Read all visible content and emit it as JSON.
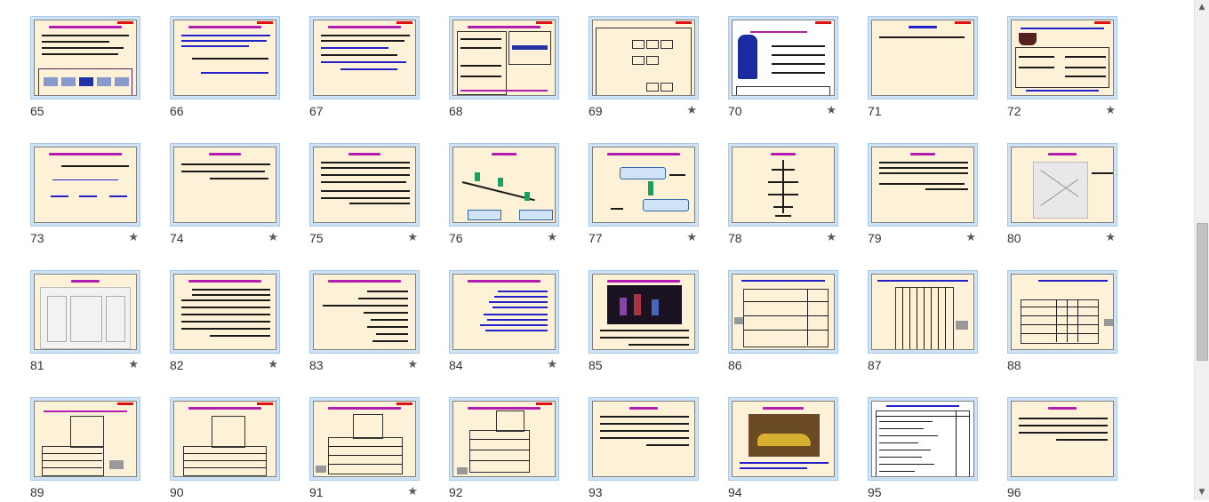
{
  "slides": [
    {
      "number": "65",
      "star": ""
    },
    {
      "number": "66",
      "star": ""
    },
    {
      "number": "67",
      "star": ""
    },
    {
      "number": "68",
      "star": ""
    },
    {
      "number": "69",
      "star": "★"
    },
    {
      "number": "70",
      "star": "★"
    },
    {
      "number": "71",
      "star": ""
    },
    {
      "number": "72",
      "star": "★"
    },
    {
      "number": "73",
      "star": "★"
    },
    {
      "number": "74",
      "star": "★"
    },
    {
      "number": "75",
      "star": "★"
    },
    {
      "number": "76",
      "star": "★"
    },
    {
      "number": "77",
      "star": "★"
    },
    {
      "number": "78",
      "star": "★"
    },
    {
      "number": "79",
      "star": "★"
    },
    {
      "number": "80",
      "star": "★"
    },
    {
      "number": "81",
      "star": "★"
    },
    {
      "number": "82",
      "star": "★"
    },
    {
      "number": "83",
      "star": "★"
    },
    {
      "number": "84",
      "star": "★"
    },
    {
      "number": "85",
      "star": ""
    },
    {
      "number": "86",
      "star": ""
    },
    {
      "number": "87",
      "star": ""
    },
    {
      "number": "88",
      "star": ""
    },
    {
      "number": "89",
      "star": ""
    },
    {
      "number": "90",
      "star": ""
    },
    {
      "number": "91",
      "star": "★"
    },
    {
      "number": "92",
      "star": ""
    },
    {
      "number": "93",
      "star": ""
    },
    {
      "number": "94",
      "star": ""
    },
    {
      "number": "95",
      "star": ""
    },
    {
      "number": "96",
      "star": ""
    }
  ],
  "scrollbar": {
    "up_icon": "▲",
    "down_icon": "▼"
  },
  "colors": {
    "slide_bg": "#fdf2d7",
    "thumb_frame": "#cfe3f6",
    "title_accent": "#b21cb0",
    "corner_mark": "#dd1111"
  }
}
